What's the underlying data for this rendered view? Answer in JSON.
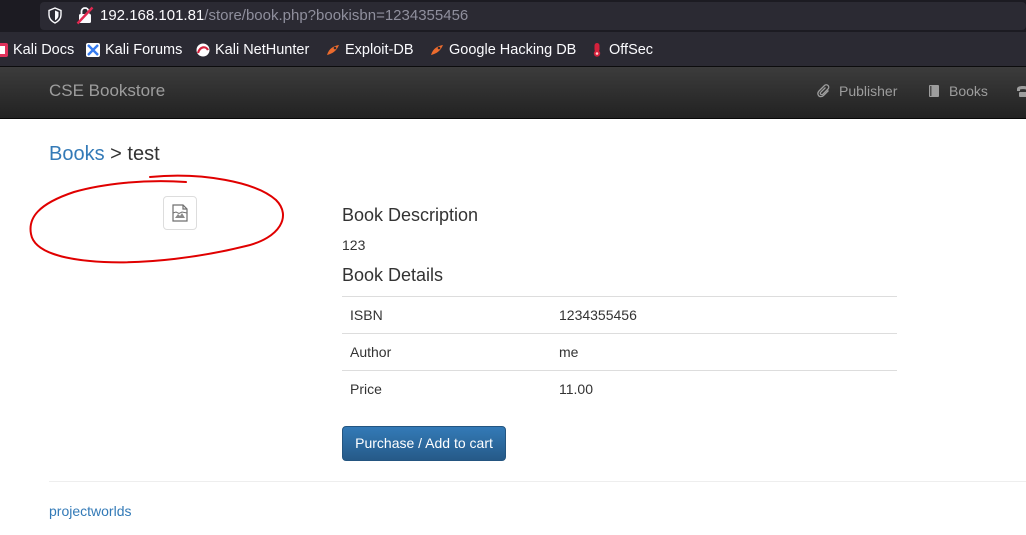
{
  "browser": {
    "url_host": "192.168.101.81",
    "url_path": "/store/book.php?bookisbn=1234355456",
    "bookmarks": [
      {
        "label": "Kali Docs",
        "icon": "kali-docs-icon"
      },
      {
        "label": "Kali Forums",
        "icon": "kali-forums-icon"
      },
      {
        "label": "Kali NetHunter",
        "icon": "kali-nethunter-icon"
      },
      {
        "label": "Exploit-DB",
        "icon": "exploit-db-icon"
      },
      {
        "label": "Google Hacking DB",
        "icon": "google-hacking-db-icon"
      },
      {
        "label": "OffSec",
        "icon": "offsec-icon"
      }
    ]
  },
  "navbar": {
    "brand": "CSE Bookstore",
    "links": [
      {
        "label": "Publisher",
        "icon": "paperclip-icon"
      },
      {
        "label": "Books",
        "icon": "book-icon"
      }
    ]
  },
  "breadcrumb": {
    "parent": "Books",
    "separator": " > ",
    "current": "test"
  },
  "book": {
    "description_heading": "Book Description",
    "description": "123",
    "details_heading": "Book Details",
    "details": [
      {
        "label": "ISBN",
        "value": "1234355456"
      },
      {
        "label": "Author",
        "value": "me"
      },
      {
        "label": "Price",
        "value": "11.00"
      }
    ],
    "image_icon": "broken-image-icon"
  },
  "actions": {
    "purchase_label": "Purchase / Add to cart"
  },
  "footer": {
    "link_text": "projectworlds"
  },
  "colors": {
    "link": "#337ab7",
    "button": "#337ab7",
    "navbar": "#222222",
    "annotation": "#e00000"
  }
}
